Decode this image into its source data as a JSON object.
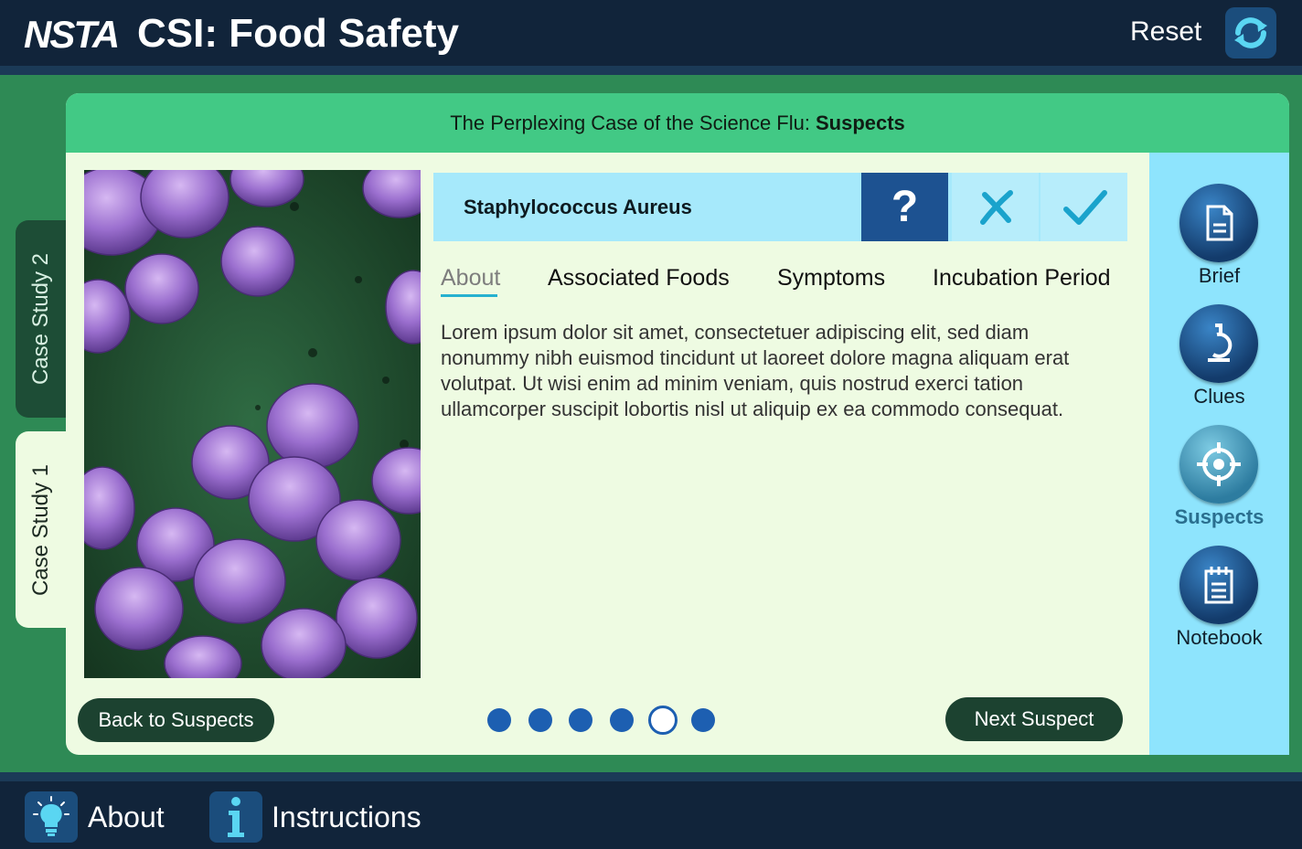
{
  "header": {
    "logo": "NSTA",
    "title": "CSI: Food Safety",
    "reset_label": "Reset"
  },
  "case": {
    "title_prefix": "The Perplexing Case of the Science Flu:",
    "title_bold": "Suspects"
  },
  "side_tabs": [
    {
      "label": "Case Study 2",
      "active": false
    },
    {
      "label": "Case Study 1",
      "active": true
    }
  ],
  "suspect": {
    "name": "Staphylococcus Aureus",
    "question_mark": "?",
    "actions": [
      "question-icon",
      "x-icon",
      "check-icon"
    ]
  },
  "tabs": [
    {
      "label": "About",
      "active": true
    },
    {
      "label": "Associated Foods",
      "active": false
    },
    {
      "label": "Symptoms",
      "active": false
    },
    {
      "label": "Incubation Period",
      "active": false
    }
  ],
  "about_text": "Lorem ipsum dolor sit amet, consectetuer adipiscing elit, sed diam nonummy nibh euismod tincidunt ut laoreet dolore magna aliquam erat volutpat. Ut wisi enim ad minim veniam, quis nostrud exerci tation ullamcorper suscipit lobortis nisl ut aliquip ex ea commodo consequat.",
  "nav_buttons": {
    "back": "Back to Suspects",
    "next": "Next Suspect"
  },
  "pagination": {
    "total": 6,
    "current": 5
  },
  "right_nav": [
    {
      "label": "Brief",
      "icon": "document-icon",
      "active": false
    },
    {
      "label": "Clues",
      "icon": "microscope-icon",
      "active": false
    },
    {
      "label": "Suspects",
      "icon": "crosshair-icon",
      "active": true
    },
    {
      "label": "Notebook",
      "icon": "notebook-icon",
      "active": false
    }
  ],
  "footer": {
    "about_label": "About",
    "instructions_label": "Instructions"
  },
  "colors": {
    "header_bg": "#11243a",
    "stage_green": "#2e8a55",
    "card_head": "#42c985",
    "suspect_bar": "#a6e9fb",
    "accent_blue": "#1d5291",
    "right_nav_bg": "#8ee4fd"
  }
}
